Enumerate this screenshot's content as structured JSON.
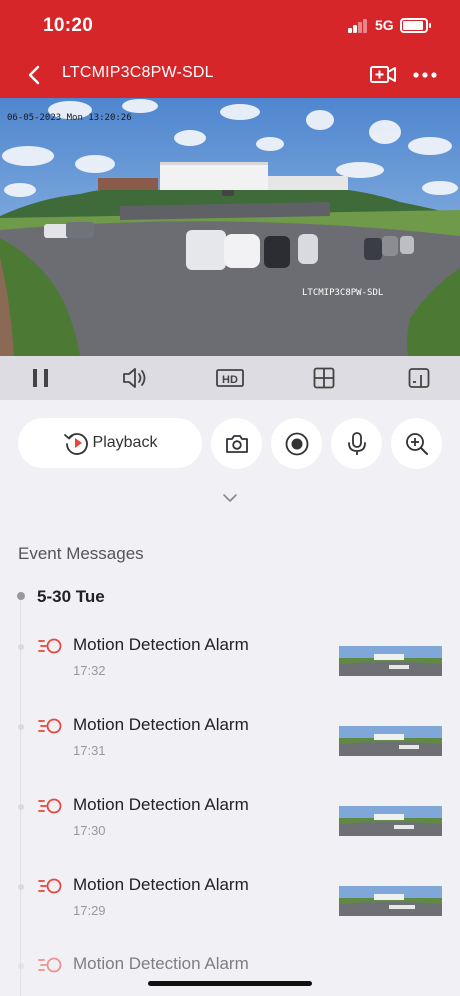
{
  "status_bar": {
    "time": "10:20",
    "network": "5G"
  },
  "nav": {
    "title": "LTCMIP3C8PW-SDL",
    "icons": [
      "back-chevron",
      "add-video-icon",
      "more-icon"
    ]
  },
  "video": {
    "osd_time": "06-05-2023 Mon 13:20:26",
    "osd_name": "LTCMIP3C8PW-SDL"
  },
  "toolbar": {
    "hd_label": "HD",
    "icons": [
      "pause-icon",
      "volume-icon",
      "hd-icon",
      "grid-icon",
      "device-switch-icon"
    ]
  },
  "actions": {
    "playback_label": "Playback",
    "icons": [
      "playback-icon",
      "camera-icon",
      "record-icon",
      "microphone-icon",
      "zoom-in-icon"
    ]
  },
  "events": {
    "section_title": "Event Messages",
    "date": "5-30 Tue",
    "items": [
      {
        "title": "Motion Detection Alarm",
        "time": "17:32"
      },
      {
        "title": "Motion Detection Alarm",
        "time": "17:31"
      },
      {
        "title": "Motion Detection Alarm",
        "time": "17:30"
      },
      {
        "title": "Motion Detection Alarm",
        "time": "17:29"
      },
      {
        "title": "Motion Detection Alarm",
        "time": ""
      }
    ]
  },
  "colors": {
    "brand_red": "#d7262a",
    "alarm_red": "#e8453c",
    "background": "#f0f0f5",
    "toolbar": "#dcdce2"
  }
}
